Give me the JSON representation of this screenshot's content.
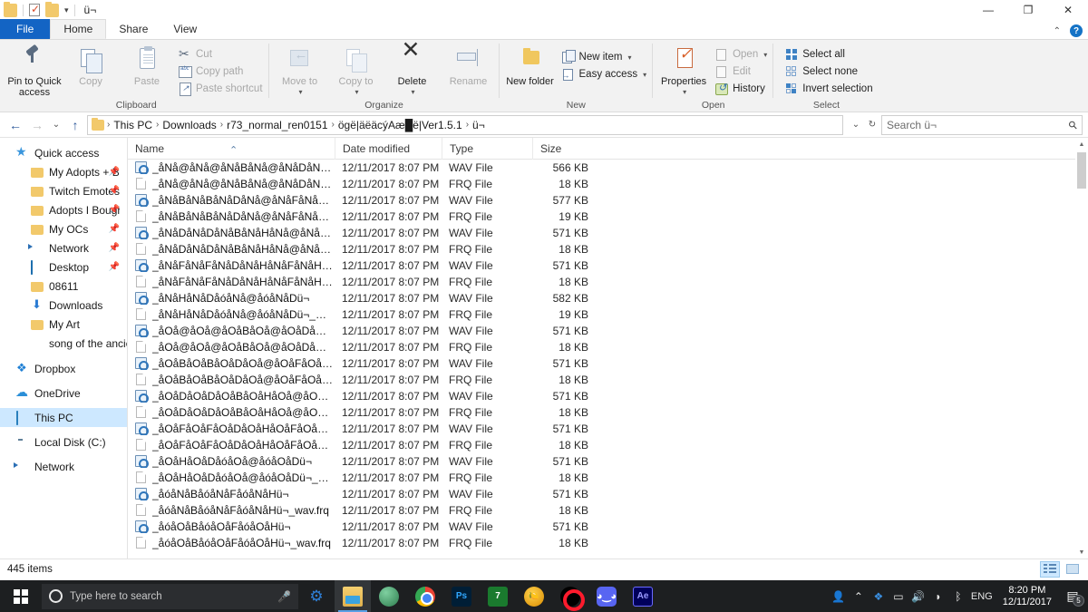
{
  "window": {
    "title": "ü¬",
    "quick_access_icons": [
      "folder-icon",
      "properties-check-icon",
      "folder-icon"
    ],
    "controls": {
      "minimize": "—",
      "restore": "❐",
      "close": "✕"
    },
    "ribbon_collapse": "⌃",
    "help": "?"
  },
  "tabs": [
    {
      "label": "File",
      "id": "file"
    },
    {
      "label": "Home",
      "id": "home"
    },
    {
      "label": "Share",
      "id": "share"
    },
    {
      "label": "View",
      "id": "view"
    }
  ],
  "ribbon": {
    "groups": [
      {
        "title": "Clipboard",
        "big": [
          {
            "label": "Pin to Quick access",
            "icon": "pin-icon",
            "dim": false
          },
          {
            "label": "Copy",
            "icon": "copy-icon",
            "dim": true
          },
          {
            "label": "Paste",
            "icon": "paste-icon",
            "dim": true
          }
        ],
        "small": [
          {
            "label": "Cut",
            "icon": "scissors-icon",
            "dim": true
          },
          {
            "label": "Copy path",
            "icon": "copy-path-icon",
            "dim": true
          },
          {
            "label": "Paste shortcut",
            "icon": "paste-shortcut-icon",
            "dim": true
          }
        ]
      },
      {
        "title": "Organize",
        "big": [
          {
            "label": "Move to",
            "icon": "move-to-icon",
            "dim": true,
            "caret": "▾"
          },
          {
            "label": "Copy to",
            "icon": "copy-to-icon",
            "dim": true,
            "caret": "▾"
          },
          {
            "label": "Delete",
            "icon": "delete-icon",
            "dim": false,
            "caret": "▾"
          },
          {
            "label": "Rename",
            "icon": "rename-icon",
            "dim": true
          }
        ],
        "small": []
      },
      {
        "title": "New",
        "big": [
          {
            "label": "New folder",
            "icon": "new-folder-icon",
            "dim": false
          }
        ],
        "small": [
          {
            "label": "New item",
            "icon": "new-item-icon",
            "dim": false,
            "caret": "▾"
          },
          {
            "label": "Easy access",
            "icon": "easy-access-icon",
            "dim": false,
            "caret": "▾"
          }
        ]
      },
      {
        "title": "Open",
        "big": [
          {
            "label": "Properties",
            "icon": "properties-icon",
            "dim": false,
            "caret": "▾"
          }
        ],
        "small": [
          {
            "label": "Open",
            "icon": "open-icon",
            "dim": true,
            "caret": "▾"
          },
          {
            "label": "Edit",
            "icon": "edit-icon",
            "dim": true
          },
          {
            "label": "History",
            "icon": "history-icon",
            "dim": false
          }
        ]
      },
      {
        "title": "Select",
        "big": [],
        "small": [
          {
            "label": "Select all",
            "icon": "select-all-icon",
            "dim": false
          },
          {
            "label": "Select none",
            "icon": "select-none-icon",
            "dim": false
          },
          {
            "label": "Invert selection",
            "icon": "invert-selection-icon",
            "dim": false
          }
        ]
      }
    ]
  },
  "address_bar": {
    "back": "←",
    "forward": "→",
    "recent": "⌄",
    "up": "↑",
    "crumbs": [
      "This PC",
      "Downloads",
      "r73_normal_ren0151",
      "ögë|äëäcýAæ█ë|Ver1.5.1",
      "ü¬"
    ],
    "crumb_separator": "›",
    "dropdown": "⌄",
    "refresh": "↻",
    "search_placeholder": "Search ü¬",
    "search_value": "",
    "search_icon": "magnifier-icon"
  },
  "nav_pane": {
    "items": [
      {
        "label": "Quick access",
        "icon": "star-icon",
        "level": "root",
        "pinned": false,
        "selected": false
      },
      {
        "label": "My Adopts + Ba:",
        "icon": "folder-icon",
        "level": "child",
        "pinned": true,
        "selected": false
      },
      {
        "label": "Twitch EmotesC‹",
        "icon": "folder-icon",
        "level": "child",
        "pinned": true,
        "selected": false
      },
      {
        "label": "Adopts I Bought",
        "icon": "folder-icon",
        "level": "child",
        "pinned": true,
        "selected": false
      },
      {
        "label": "My OCs",
        "icon": "folder-icon",
        "level": "child",
        "pinned": true,
        "selected": false
      },
      {
        "label": "Network",
        "icon": "network-icon",
        "level": "child",
        "pinned": true,
        "selected": false
      },
      {
        "label": "Desktop",
        "icon": "desktop-icon",
        "level": "child",
        "pinned": true,
        "selected": false
      },
      {
        "label": "08611",
        "icon": "folder-icon",
        "level": "child",
        "pinned": false,
        "selected": false
      },
      {
        "label": "Downloads",
        "icon": "downloads-icon",
        "level": "child",
        "pinned": false,
        "selected": false
      },
      {
        "label": "My Art",
        "icon": "folder-icon",
        "level": "child",
        "pinned": false,
        "selected": false
      },
      {
        "label": "song of the ancient",
        "icon": "library-icon",
        "level": "child",
        "pinned": false,
        "selected": false
      },
      {
        "label": "Dropbox",
        "icon": "dropbox-icon",
        "level": "root",
        "pinned": false,
        "selected": false
      },
      {
        "label": "OneDrive",
        "icon": "onedrive-icon",
        "level": "root",
        "pinned": false,
        "selected": false
      },
      {
        "label": "This PC",
        "icon": "this-pc-icon",
        "level": "root",
        "pinned": false,
        "selected": true
      },
      {
        "label": "Local Disk (C:)",
        "icon": "disk-icon",
        "level": "root",
        "pinned": false,
        "selected": false
      },
      {
        "label": "Network",
        "icon": "network-icon",
        "level": "root",
        "pinned": false,
        "selected": false
      }
    ]
  },
  "file_list": {
    "columns": [
      {
        "label": "Name",
        "key": "name",
        "sorted": "asc"
      },
      {
        "label": "Date modified",
        "key": "date"
      },
      {
        "label": "Type",
        "key": "type"
      },
      {
        "label": "Size",
        "key": "size"
      }
    ],
    "sort_indicator": "⌃",
    "rows": [
      {
        "name": "_åNå@åNå@åNåBåNå@åNåDåNåFåNå@...",
        "date": "12/11/2017 8:07 PM",
        "type": "WAV File",
        "size": "566 KB",
        "icon": "wav-file-icon"
      },
      {
        "name": "_åNå@åNå@åNåBåNå@åNåDåNåFåNå@...",
        "date": "12/11/2017 8:07 PM",
        "type": "FRQ File",
        "size": "18 KB",
        "icon": "frq-file-icon"
      },
      {
        "name": "_åNåBåNåBåNåDåNå@åNåFåNåBåNåFü¬",
        "date": "12/11/2017 8:07 PM",
        "type": "WAV File",
        "size": "577 KB",
        "icon": "wav-file-icon"
      },
      {
        "name": "_åNåBåNåBåNåDåNå@åNåFåNåBåNåFü...",
        "date": "12/11/2017 8:07 PM",
        "type": "FRQ File",
        "size": "19 KB",
        "icon": "frq-file-icon"
      },
      {
        "name": "_åNåDåNåDåNåBåNåHåNå@åNåHåNåBü¬",
        "date": "12/11/2017 8:07 PM",
        "type": "WAV File",
        "size": "571 KB",
        "icon": "wav-file-icon"
      },
      {
        "name": "_åNåDåNåDåNåBåNåHåNå@åNåHåNåB...",
        "date": "12/11/2017 8:07 PM",
        "type": "FRQ File",
        "size": "18 KB",
        "icon": "frq-file-icon"
      },
      {
        "name": "_åNåFåNåFåNåDåNåHåNåFåNåHåNåHü¬",
        "date": "12/11/2017 8:07 PM",
        "type": "WAV File",
        "size": "571 KB",
        "icon": "wav-file-icon"
      },
      {
        "name": "_åNåFåNåFåNåDåNåHåNåFåNåHåNåHü...",
        "date": "12/11/2017 8:07 PM",
        "type": "FRQ File",
        "size": "18 KB",
        "icon": "frq-file-icon"
      },
      {
        "name": "_åNåHåNåDåóåNå@åóåNåDü¬",
        "date": "12/11/2017 8:07 PM",
        "type": "WAV File",
        "size": "582 KB",
        "icon": "wav-file-icon"
      },
      {
        "name": "_åNåHåNåDåóåNå@åóåNåDü¬_wav.frq",
        "date": "12/11/2017 8:07 PM",
        "type": "FRQ File",
        "size": "19 KB",
        "icon": "frq-file-icon"
      },
      {
        "name": "_åOå@åOå@åOåBåOå@åOåDåOåFåOå@...",
        "date": "12/11/2017 8:07 PM",
        "type": "WAV File",
        "size": "571 KB",
        "icon": "wav-file-icon"
      },
      {
        "name": "_åOå@åOå@åOåBåOå@åOåDåOåFåOå@...",
        "date": "12/11/2017 8:07 PM",
        "type": "FRQ File",
        "size": "18 KB",
        "icon": "frq-file-icon"
      },
      {
        "name": "_åOåBåOåBåOåDåOå@åOåFåOåBåOåFü¬",
        "date": "12/11/2017 8:07 PM",
        "type": "WAV File",
        "size": "571 KB",
        "icon": "wav-file-icon"
      },
      {
        "name": "_åOåBåOåBåOåDåOå@åOåFåOåBåOåFü...",
        "date": "12/11/2017 8:07 PM",
        "type": "FRQ File",
        "size": "18 KB",
        "icon": "frq-file-icon"
      },
      {
        "name": "_åOåDåOåDåOåBåOåHåOå@åOåHåOåBü¬",
        "date": "12/11/2017 8:07 PM",
        "type": "WAV File",
        "size": "571 KB",
        "icon": "wav-file-icon"
      },
      {
        "name": "_åOåDåOåDåOåBåOåHåOå@åOåHåOåB...",
        "date": "12/11/2017 8:07 PM",
        "type": "FRQ File",
        "size": "18 KB",
        "icon": "frq-file-icon"
      },
      {
        "name": "_åOåFåOåFåOåDåOåHåOåFåOåHåOåHü¬",
        "date": "12/11/2017 8:07 PM",
        "type": "WAV File",
        "size": "571 KB",
        "icon": "wav-file-icon"
      },
      {
        "name": "_åOåFåOåFåOåDåOåHåOåFåOåHåOåHü...",
        "date": "12/11/2017 8:07 PM",
        "type": "FRQ File",
        "size": "18 KB",
        "icon": "frq-file-icon"
      },
      {
        "name": "_åOåHåOåDåóåOå@åóåOåDü¬",
        "date": "12/11/2017 8:07 PM",
        "type": "WAV File",
        "size": "571 KB",
        "icon": "wav-file-icon"
      },
      {
        "name": "_åOåHåOåDåóåOå@åóåOåDü¬_wav.frq",
        "date": "12/11/2017 8:07 PM",
        "type": "FRQ File",
        "size": "18 KB",
        "icon": "frq-file-icon"
      },
      {
        "name": "_åóåNåBåóåNåFåóåNåHü¬",
        "date": "12/11/2017 8:07 PM",
        "type": "WAV File",
        "size": "571 KB",
        "icon": "wav-file-icon"
      },
      {
        "name": "_åóåNåBåóåNåFåóåNåHü¬_wav.frq",
        "date": "12/11/2017 8:07 PM",
        "type": "FRQ File",
        "size": "18 KB",
        "icon": "frq-file-icon"
      },
      {
        "name": "_åóåOåBåóåOåFåóåOåHü¬",
        "date": "12/11/2017 8:07 PM",
        "type": "WAV File",
        "size": "571 KB",
        "icon": "wav-file-icon"
      },
      {
        "name": "_åóåOåBåóåOåFåóåOåHü¬_wav.frq",
        "date": "12/11/2017 8:07 PM",
        "type": "FRQ File",
        "size": "18 KB",
        "icon": "frq-file-icon"
      }
    ]
  },
  "status_bar": {
    "item_count": "445 items",
    "views": [
      {
        "name": "details-view",
        "selected": true
      },
      {
        "name": "large-icons-view",
        "selected": false
      }
    ]
  },
  "taskbar": {
    "start": "start-button",
    "search_placeholder": "Type here to search",
    "mic": "microphone-icon",
    "apps": [
      {
        "name": "settings-gear-icon",
        "label": "",
        "cls": "app-gear",
        "active": false
      },
      {
        "name": "file-explorer-icon",
        "label": "",
        "cls": "app-explorer",
        "active": true
      },
      {
        "name": "paint-globe-icon",
        "label": "",
        "cls": "app-globe",
        "active": false
      },
      {
        "name": "chrome-icon",
        "label": "",
        "cls": "app-chrome",
        "active": false
      },
      {
        "name": "photoshop-icon",
        "label": "Ps",
        "cls": "app-ps",
        "active": false
      },
      {
        "name": "seven-zip-icon",
        "label": "7",
        "cls": "app-7z",
        "active": false
      },
      {
        "name": "fl-studio-icon",
        "label": "",
        "cls": "app-fl",
        "active": false
      },
      {
        "name": "opera-gx-icon",
        "label": "",
        "cls": "app-opera",
        "active": false
      },
      {
        "name": "discord-icon",
        "label": "",
        "cls": "app-discord",
        "active": false
      },
      {
        "name": "after-effects-icon",
        "label": "Ae",
        "cls": "app-ae",
        "active": false
      }
    ],
    "tray": [
      {
        "name": "people-icon",
        "glyph": "👤"
      },
      {
        "name": "show-hidden-icons-chevron",
        "glyph": "⌃"
      },
      {
        "name": "dropbox-tray-icon",
        "glyph": "❖"
      },
      {
        "name": "battery-icon",
        "glyph": "🔋"
      },
      {
        "name": "volume-icon",
        "glyph": "🔊"
      },
      {
        "name": "wifi-icon",
        "glyph": "📶"
      },
      {
        "name": "bluetooth-icon",
        "glyph": "ᛒ"
      }
    ],
    "language": "ENG",
    "time": "8:20 PM",
    "date": "12/11/2017",
    "notifications_count": "5",
    "notification_icon": "action-center-icon"
  }
}
